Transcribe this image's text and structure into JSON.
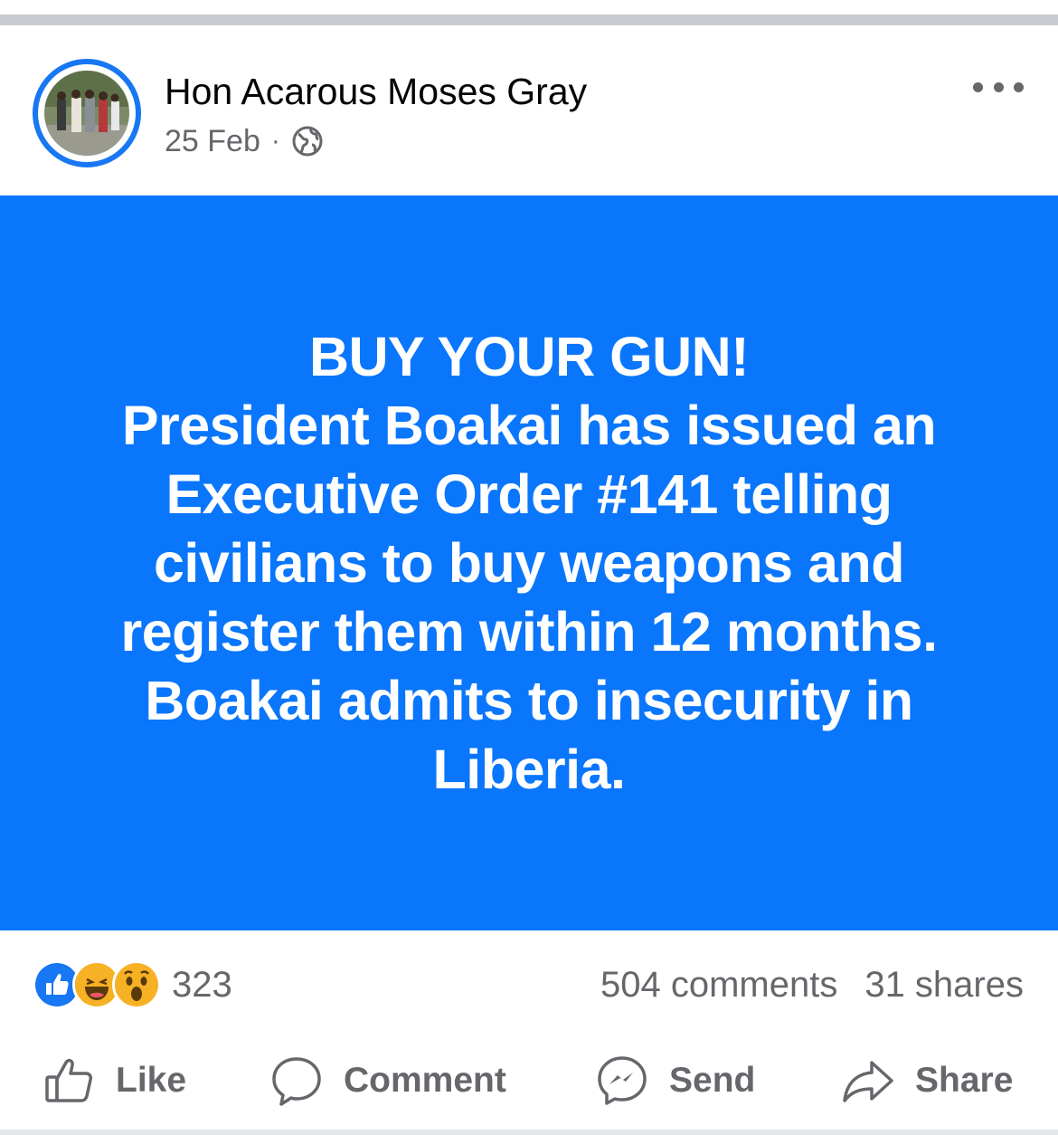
{
  "post": {
    "author": "Hon Acarous Moses Gray",
    "date": "25 Feb",
    "separator": "·",
    "privacy_icon": "globe-icon",
    "more_icon": "more-options-icon",
    "card_color": "#0a76fb",
    "text_lines": [
      "BUY YOUR GUN!",
      "President Boakai has issued an",
      "Executive Order #141 telling",
      "civilians to buy weapons and",
      "register them within 12 months.",
      "Boakai admits to insecurity in",
      "Liberia."
    ]
  },
  "stats": {
    "reactions": [
      "like-reaction-icon",
      "haha-reaction-icon",
      "wow-reaction-icon"
    ],
    "reaction_count": "323",
    "comments": "504 comments",
    "shares": "31 shares"
  },
  "actions": {
    "like": "Like",
    "comment": "Comment",
    "send": "Send",
    "share": "Share"
  }
}
